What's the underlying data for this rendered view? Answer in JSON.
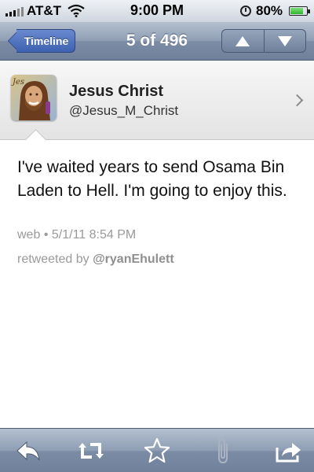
{
  "status_bar": {
    "carrier": "AT&T",
    "time": "9:00 PM",
    "battery": "80%",
    "battery_level": 0.8
  },
  "nav_bar": {
    "back_label": "Timeline",
    "title": "5 of 496"
  },
  "user": {
    "display_name": "Jesus Christ",
    "handle": "@Jesus_M_Christ",
    "avatar_text": "Jes"
  },
  "tweet": {
    "text": "I've waited years to send Osama Bin Laden to Hell. I'm going to enjoy this.",
    "source": "web",
    "separator": "•",
    "timestamp": "5/1/11 8:54 PM",
    "retweeted_by_label": "retweeted by",
    "retweeted_by_user": "@ryanEhulett"
  },
  "toolbar": {
    "items": [
      {
        "icon": "reply-icon"
      },
      {
        "icon": "retweet-icon"
      },
      {
        "icon": "star-icon"
      },
      {
        "icon": "paperclip-icon"
      },
      {
        "icon": "share-icon"
      }
    ]
  },
  "colors": {
    "nav_gradient_top": "#b4c0d0",
    "nav_gradient_bottom": "#6f809b",
    "back_button": "#3d62b0",
    "meta_gray": "#9a9a9a"
  }
}
